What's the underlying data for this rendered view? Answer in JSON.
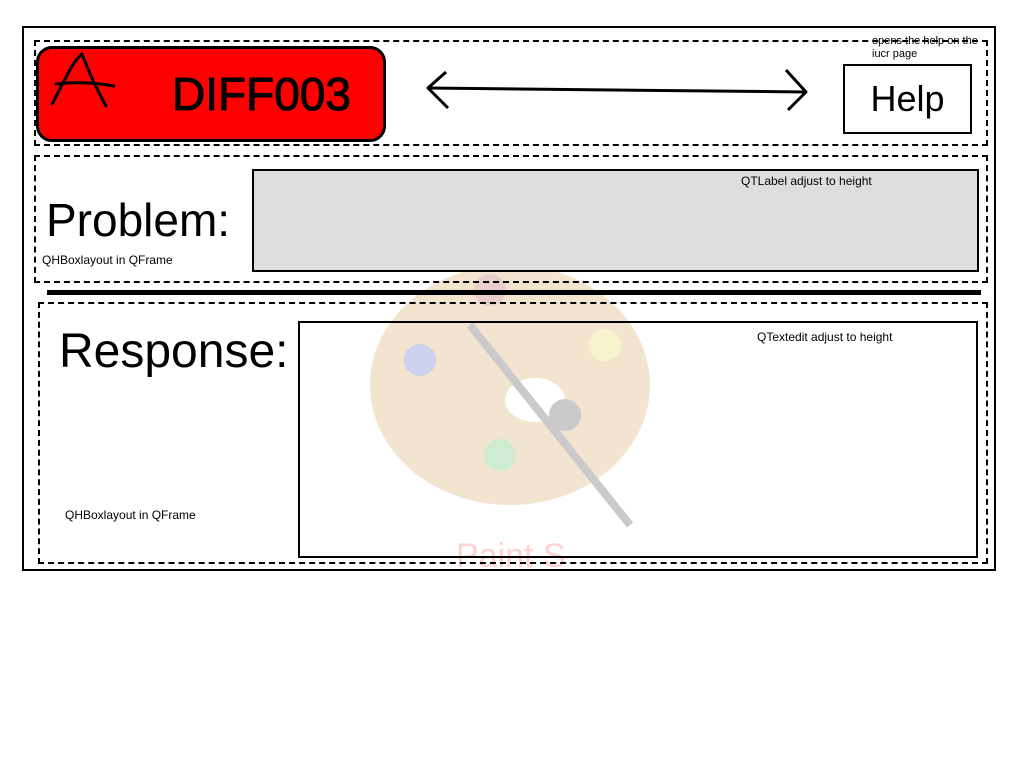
{
  "header": {
    "badge_letter": "A",
    "badge_code": "DIFF003",
    "help_note": "opens the help on the iucr page",
    "help_label": "Help",
    "badge_color": "#ff0000"
  },
  "problem": {
    "title": "Problem:",
    "layout_note": "QHBoxlayout in QFrame",
    "label_note": "QTLabel adjust to height",
    "label_color": "#dedede"
  },
  "response": {
    "title": "Response:",
    "layout_note": "QHBoxlayout in QFrame",
    "edit_note": "QTextedit adjust to height"
  },
  "watermark": {
    "icon": "paint-palette-icon",
    "text": "Paint S"
  }
}
